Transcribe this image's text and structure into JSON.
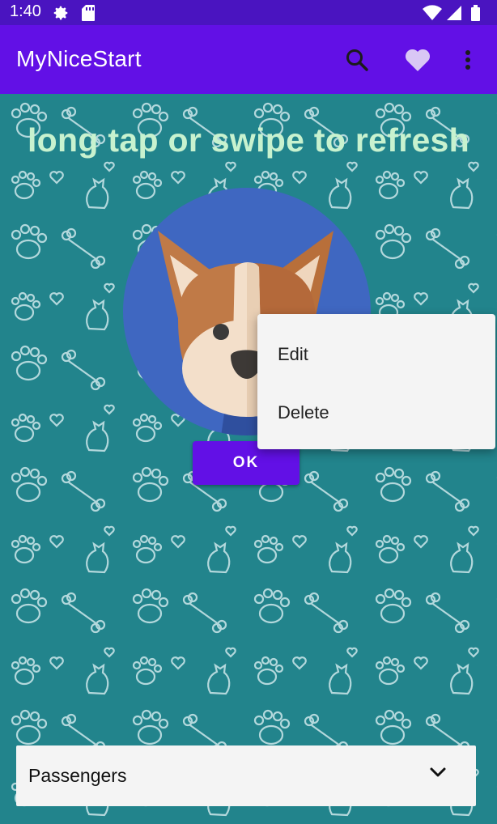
{
  "status_bar": {
    "time": "1:40",
    "icons": [
      "gear-icon",
      "sd-card-icon",
      "wifi-icon",
      "signal-icon",
      "battery-icon"
    ]
  },
  "app_bar": {
    "title": "MyNiceStart",
    "actions": [
      "search-icon",
      "heart-icon",
      "more-vert-icon"
    ],
    "color": "#6210e6"
  },
  "main": {
    "headline": "long tap or swipe to refresh",
    "image": "corgi-dog-avatar",
    "ok_button": "OK"
  },
  "popup_menu": {
    "items": [
      {
        "label": "Edit"
      },
      {
        "label": "Delete"
      }
    ]
  },
  "spinner": {
    "selected": "Passengers",
    "icon": "chevron-down-icon"
  },
  "colors": {
    "status_bar": "#4a14c0",
    "background": "#22848c",
    "headline": "#c8f2cf",
    "menu_bg": "#f4f4f4"
  }
}
